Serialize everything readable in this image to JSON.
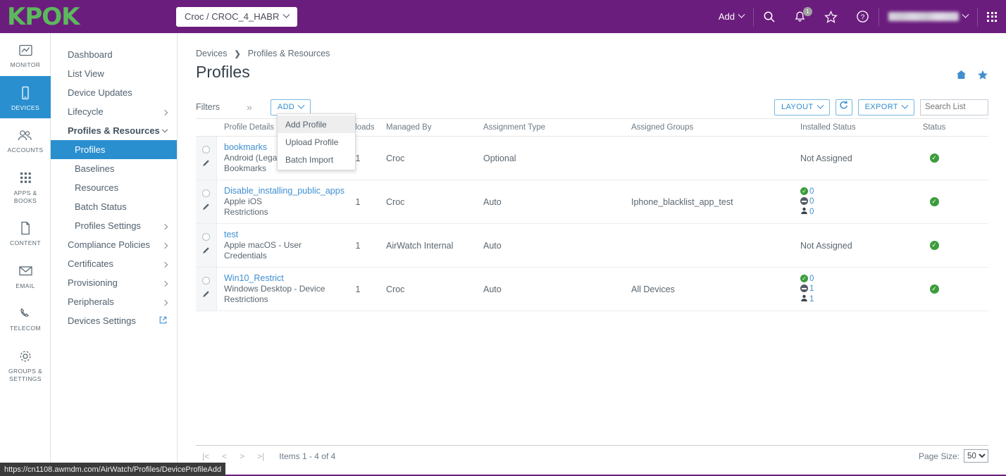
{
  "topbar": {
    "logo": "KPOK",
    "org_group": "Croc / CROC_4_HABR",
    "add_label": "Add",
    "notification_count": "1",
    "icons": [
      "search-icon",
      "bell-icon",
      "star-icon",
      "help-icon",
      "apps-grid-icon"
    ],
    "user_name": ""
  },
  "rail": {
    "items": [
      {
        "label": "MONITOR",
        "icon": "monitor-chart-icon"
      },
      {
        "label": "DEVICES",
        "icon": "device-phone-icon"
      },
      {
        "label": "ACCOUNTS",
        "icon": "accounts-people-icon"
      },
      {
        "label": "APPS & BOOKS",
        "icon": "apps-books-icon"
      },
      {
        "label": "CONTENT",
        "icon": "content-document-icon"
      },
      {
        "label": "EMAIL",
        "icon": "email-envelope-icon"
      },
      {
        "label": "TELECOM",
        "icon": "telecom-phone-icon"
      },
      {
        "label": "GROUPS & SETTINGS",
        "icon": "gear-icon"
      }
    ]
  },
  "subnav": {
    "items": [
      {
        "label": "Dashboard",
        "kind": "plain"
      },
      {
        "label": "List View",
        "kind": "plain"
      },
      {
        "label": "Device Updates",
        "kind": "plain"
      },
      {
        "label": "Lifecycle",
        "kind": "expandable"
      },
      {
        "label": "Profiles & Resources",
        "kind": "expanded"
      },
      {
        "label": "Profiles",
        "kind": "child-selected"
      },
      {
        "label": "Baselines",
        "kind": "child"
      },
      {
        "label": "Resources",
        "kind": "child"
      },
      {
        "label": "Batch Status",
        "kind": "child"
      },
      {
        "label": "Profiles Settings",
        "kind": "child-expandable"
      },
      {
        "label": "Compliance Policies",
        "kind": "expandable"
      },
      {
        "label": "Certificates",
        "kind": "expandable"
      },
      {
        "label": "Provisioning",
        "kind": "expandable"
      },
      {
        "label": "Peripherals",
        "kind": "expandable"
      },
      {
        "label": "Devices Settings",
        "kind": "external"
      }
    ]
  },
  "breadcrumb": {
    "root": "Devices",
    "current": "Profiles & Resources"
  },
  "page": {
    "title": "Profiles",
    "home_icon": "home-icon",
    "favorite_icon": "star-filled-icon"
  },
  "toolbar": {
    "filters_label": "Filters",
    "expand_icon": "double-chevron-right-icon",
    "add_label": "ADD",
    "layout_label": "LAYOUT",
    "refresh_icon": "refresh-icon",
    "export_label": "EXPORT",
    "search_placeholder": "Search List",
    "search_value": ""
  },
  "add_menu": {
    "open": true,
    "items": [
      {
        "label": "Add Profile",
        "highlighted": true
      },
      {
        "label": "Upload Profile",
        "highlighted": false
      },
      {
        "label": "Batch Import",
        "highlighted": false
      }
    ]
  },
  "table": {
    "headers": [
      "Profile Details",
      "Payloads",
      "Managed By",
      "Assignment Type",
      "Assigned Groups",
      "Installed Status",
      "Status"
    ],
    "rows": [
      {
        "name": "bookmarks",
        "platform": "Android (Legacy)",
        "type": "Bookmarks",
        "payloads": "1",
        "managed_by": "Croc",
        "assignment_type": "Optional",
        "assigned_groups": "",
        "installed_status_text": "Not Assigned",
        "installed_counts": null,
        "status": "active"
      },
      {
        "name": "Disable_installing_public_apps",
        "platform": "Apple iOS",
        "type": "Restrictions",
        "payloads": "1",
        "managed_by": "Croc",
        "assignment_type": "Auto",
        "assigned_groups": "Iphone_blacklist_app_test",
        "installed_status_text": "",
        "installed_counts": {
          "installed": "0",
          "not_installed": "0",
          "assigned": "0"
        },
        "status": "active"
      },
      {
        "name": "test",
        "platform": "Apple macOS - User",
        "type": "Credentials",
        "payloads": "1",
        "managed_by": "AirWatch Internal",
        "assignment_type": "Auto",
        "assigned_groups": "",
        "installed_status_text": "Not Assigned",
        "installed_counts": null,
        "status": "active"
      },
      {
        "name": "Win10_Restrict",
        "platform": "Windows Desktop - Device",
        "type": "Restrictions",
        "payloads": "1",
        "managed_by": "Croc",
        "assignment_type": "Auto",
        "assigned_groups": "All Devices",
        "installed_status_text": "",
        "installed_counts": {
          "installed": "0",
          "not_installed": "1",
          "assigned": "1"
        },
        "status": "active"
      }
    ]
  },
  "footer": {
    "items_label": "Items 1 - 4 of 4",
    "page_size_label": "Page Size:",
    "page_size_value": "50",
    "page_size_options": [
      "50"
    ]
  },
  "statusbar": {
    "url": "https://cn1108.awmdm.com/AirWatch/Profiles/DeviceProfileAdd"
  },
  "colors": {
    "brand_purple": "#6b1d7e",
    "logo_green": "#5cb85c",
    "accent_blue": "#2a8fcf",
    "link_blue": "#3f8fd0",
    "status_green": "#3c9c3c"
  }
}
